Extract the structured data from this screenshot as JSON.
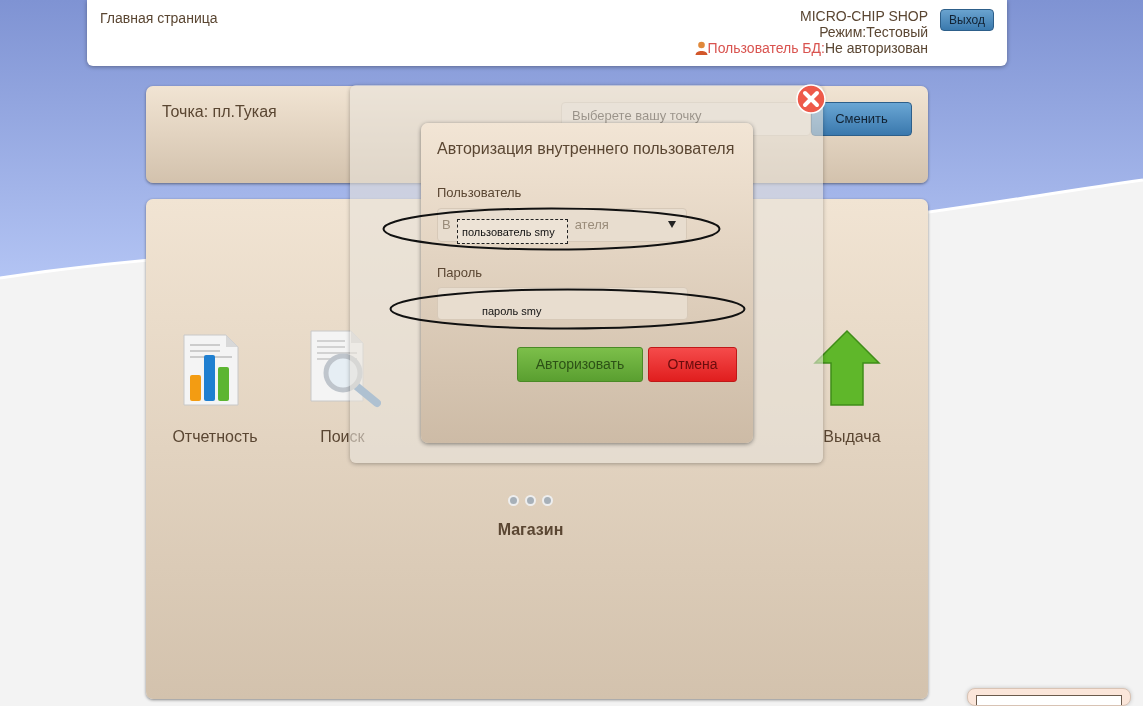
{
  "header": {
    "title": "Главная страница",
    "shop_name": "MICRO-CHIP SHOP",
    "mode": "Режим:Тестовый",
    "db_user_label": "Пользователь БД:",
    "db_user_value": "Не авторизован",
    "logout_button": "Выход"
  },
  "point_panel": {
    "label": "Точка: пл.Тукая",
    "select_placeholder": "Выберете вашу точку",
    "change_button": "Сменить"
  },
  "menu": {
    "items": [
      {
        "label": "Отчетность",
        "kind": "report"
      },
      {
        "label": "Поиск",
        "kind": "search"
      },
      {
        "label": "Выдача",
        "kind": "issue"
      }
    ],
    "section_title": "Магазин"
  },
  "dialog": {
    "title": "Авторизация внутреннего пользователя",
    "user_label": "Пользователь",
    "user_placeholder_parts": [
      "В",
      "ателя"
    ],
    "password_label": "Пароль",
    "submit_button": "Авторизовать",
    "cancel_button": "Отмена"
  },
  "annotations": [
    {
      "kind": "user",
      "text": "пользователь smy"
    },
    {
      "kind": "password",
      "text": "пароль smy"
    }
  ]
}
